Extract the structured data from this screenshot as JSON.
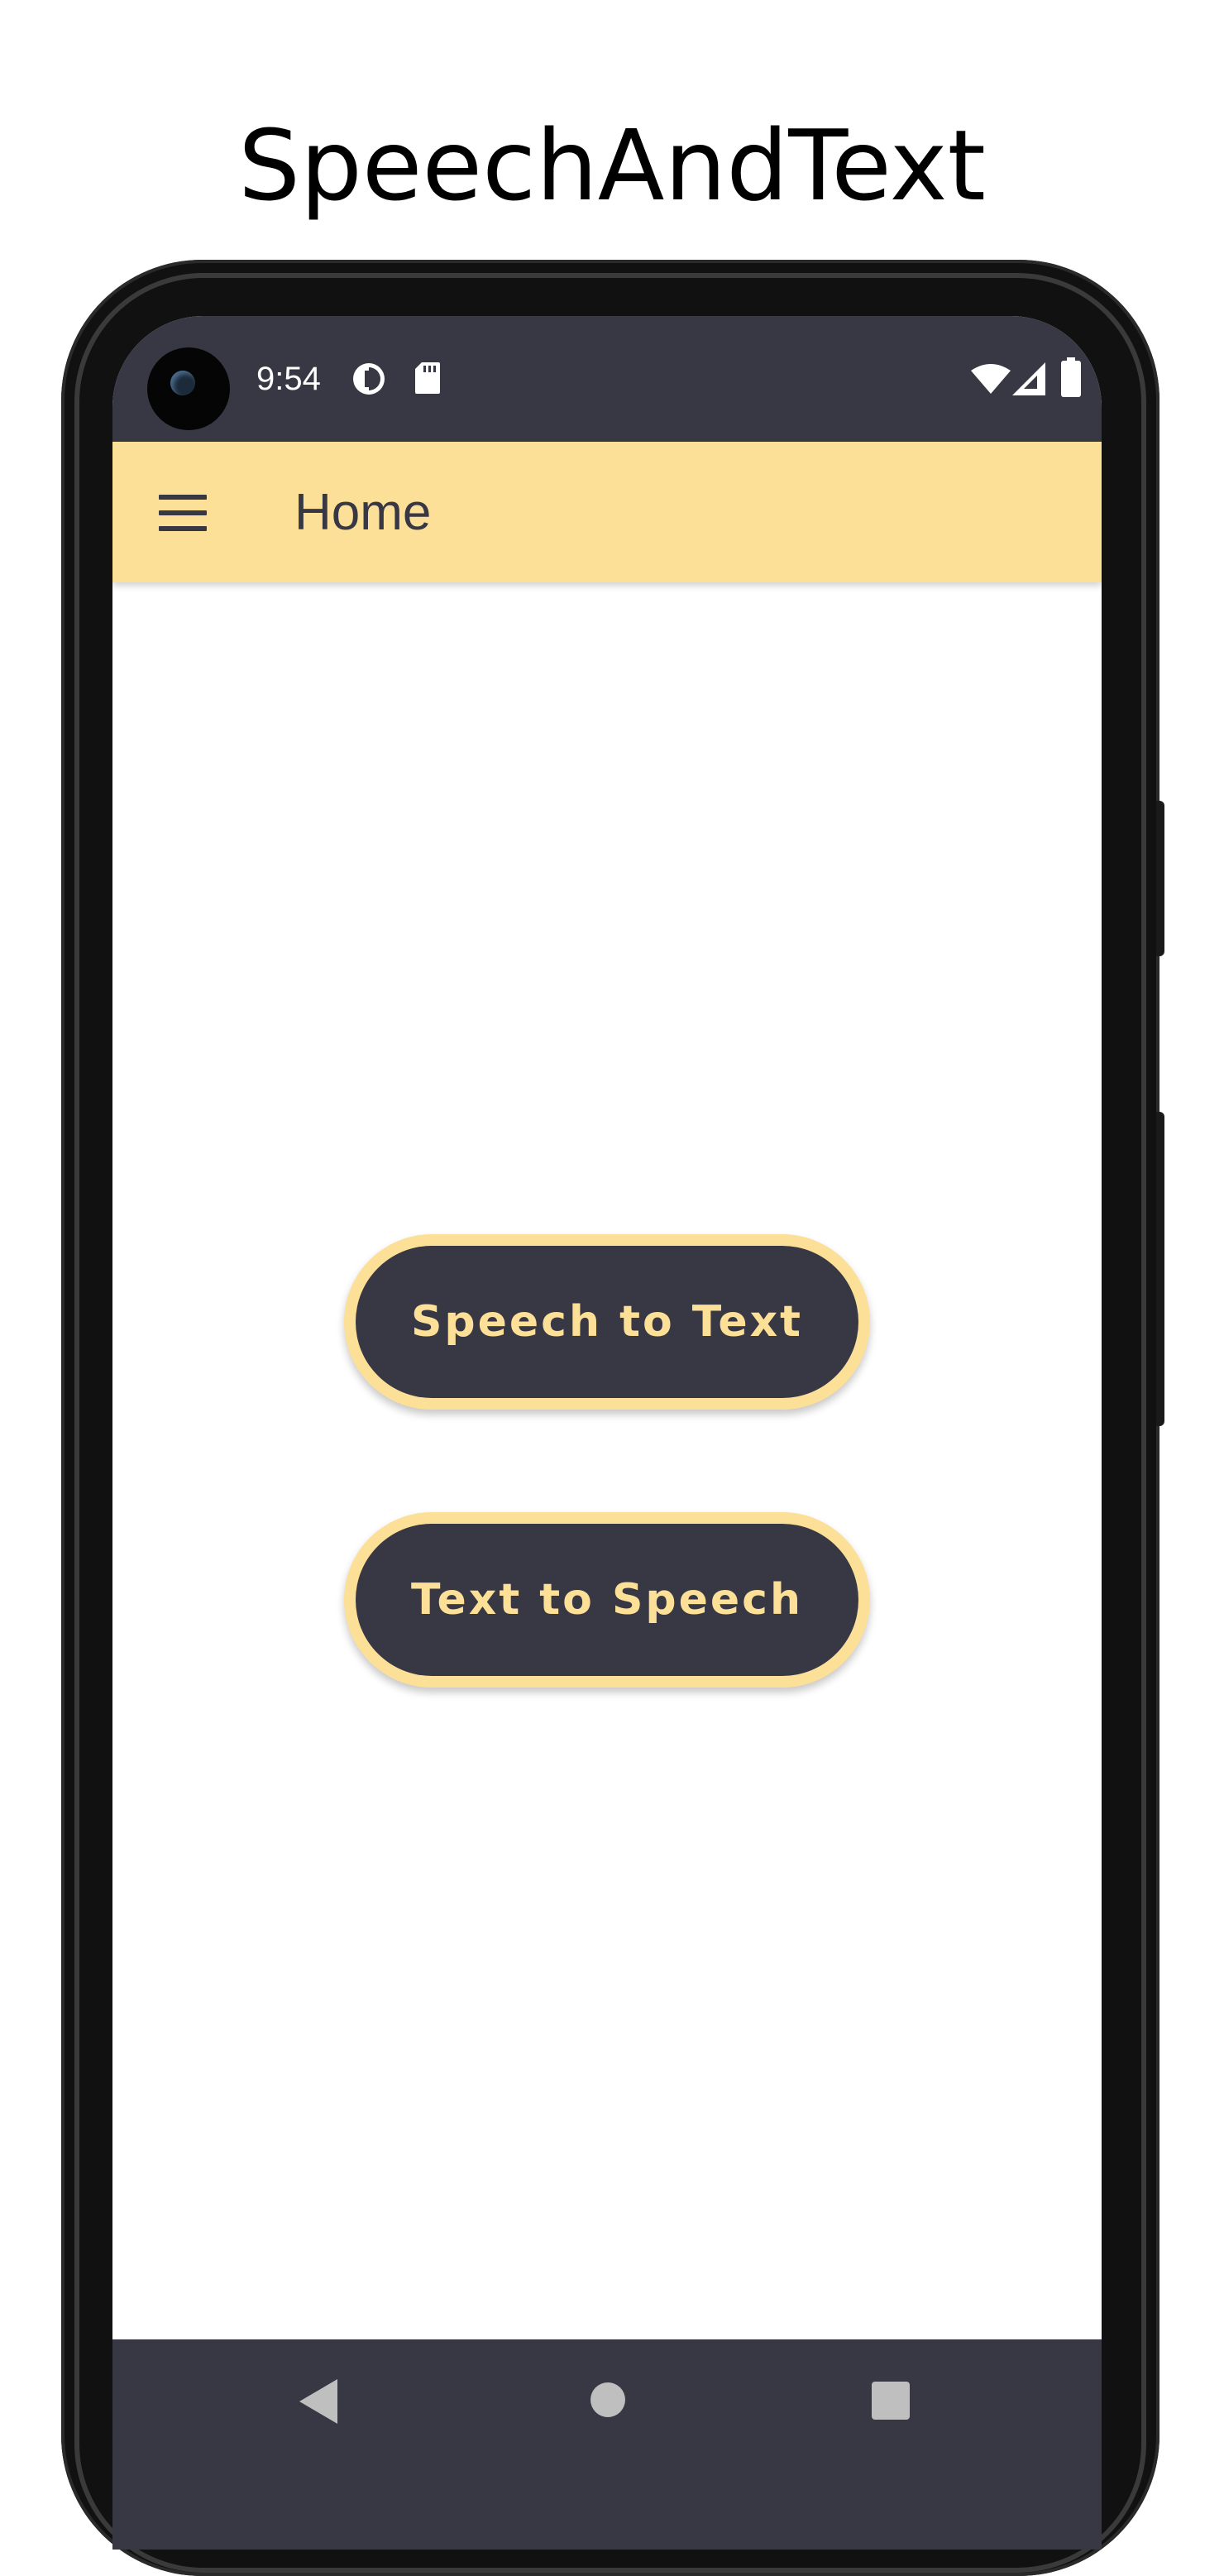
{
  "page_title": "SpeechAndText",
  "status_bar": {
    "time": "9:54",
    "icons": [
      "data-saver-icon",
      "sd-card-icon",
      "wifi-icon",
      "cell-signal-icon",
      "battery-icon"
    ]
  },
  "app_bar": {
    "menu_icon": "hamburger-menu-icon",
    "title": "Home"
  },
  "buttons": {
    "speech_to_text": "Speech to Text",
    "text_to_speech": "Text to Speech"
  },
  "nav_bar": {
    "icons": [
      "back-icon",
      "home-icon",
      "recents-icon"
    ]
  },
  "colors": {
    "accent": "#FDE097",
    "dark": "#373844",
    "background": "#FFFFFF"
  }
}
